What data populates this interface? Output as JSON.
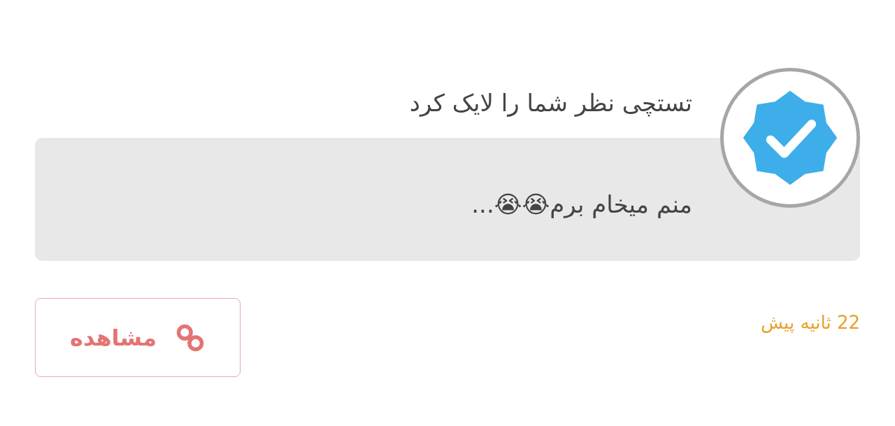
{
  "notification": {
    "title": "تستچی نظر شما را لایک کرد",
    "comment": "منم میخام برم😭😭...",
    "time": "22 ثانیه پیش",
    "button": {
      "label": "مشاهده"
    }
  }
}
